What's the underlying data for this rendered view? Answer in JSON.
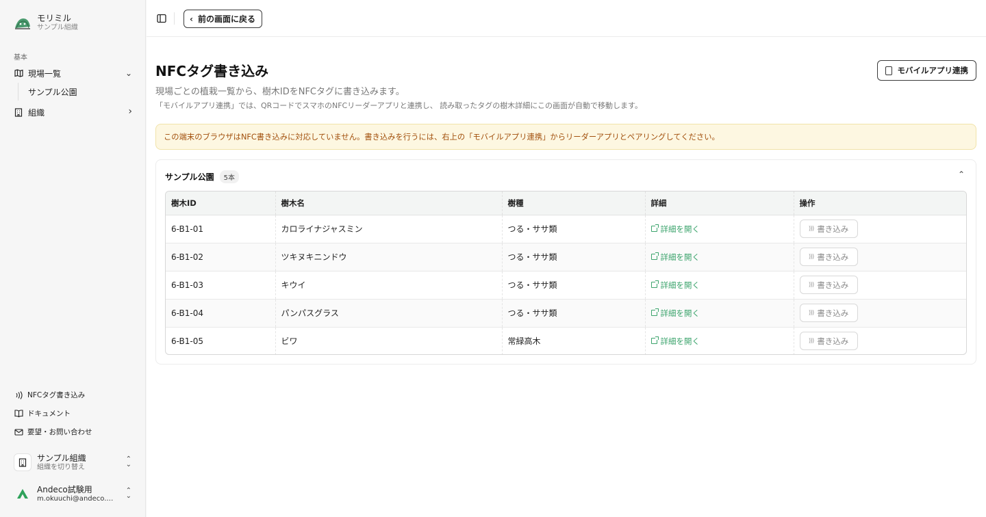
{
  "sidebar": {
    "brand_name": "モリミル",
    "brand_org": "サンプル組織",
    "section_label": "基本",
    "items": [
      {
        "label": "現場一覧",
        "icon": "map-icon"
      },
      {
        "label": "組織",
        "icon": "building-icon"
      }
    ],
    "sub_item": "サンプル公園",
    "footer": [
      {
        "label": "NFCタグ書き込み",
        "icon": "nfc-icon"
      },
      {
        "label": "ドキュメント",
        "icon": "book-icon"
      },
      {
        "label": "要望・お問い合わせ",
        "icon": "mail-icon"
      }
    ],
    "org_switcher": {
      "name": "サンプル組織",
      "hint": "組織を切り替え"
    },
    "user": {
      "name": "Andeco試験用",
      "email": "m.okuuchi@andeco.…"
    }
  },
  "topbar": {
    "back_label": "前の画面に戻る"
  },
  "page": {
    "title": "NFCタグ書き込み",
    "subtitle": "現場ごとの植栽一覧から、樹木IDをNFCタグに書き込みます。",
    "note": "「モバイルアプリ連携」では、QRコードでスマホのNFCリーダーアプリと連携し、 読み取ったタグの樹木詳細にこの画面が自動で移動します。",
    "mobile_button": "モバイルアプリ連携",
    "alert": "この端末のブラウザはNFC書き込みに対応していません。書き込みを行うには、右上の「モバイルアプリ連携」からリーダーアプリとペアリングしてください。"
  },
  "card": {
    "title": "サンプル公園",
    "count": "5本",
    "columns": [
      "樹木ID",
      "樹木名",
      "樹種",
      "詳細",
      "操作"
    ],
    "rows": [
      {
        "id": "6-B1-01",
        "name": "カロライナジャスミン",
        "species": "つる・ササ類",
        "detail": "詳細を開く",
        "action": "書き込み"
      },
      {
        "id": "6-B1-02",
        "name": "ツキヌキニンドウ",
        "species": "つる・ササ類",
        "detail": "詳細を開く",
        "action": "書き込み"
      },
      {
        "id": "6-B1-03",
        "name": "キウイ",
        "species": "つる・ササ類",
        "detail": "詳細を開く",
        "action": "書き込み"
      },
      {
        "id": "6-B1-04",
        "name": "パンパスグラス",
        "species": "つる・ササ類",
        "detail": "詳細を開く",
        "action": "書き込み"
      },
      {
        "id": "6-B1-05",
        "name": "ビワ",
        "species": "常緑高木",
        "detail": "詳細を開く",
        "action": "書き込み"
      }
    ]
  },
  "colors": {
    "accent_green": "#3aa36b",
    "alert_bg": "#fdf7e1",
    "alert_text": "#a2500d"
  }
}
